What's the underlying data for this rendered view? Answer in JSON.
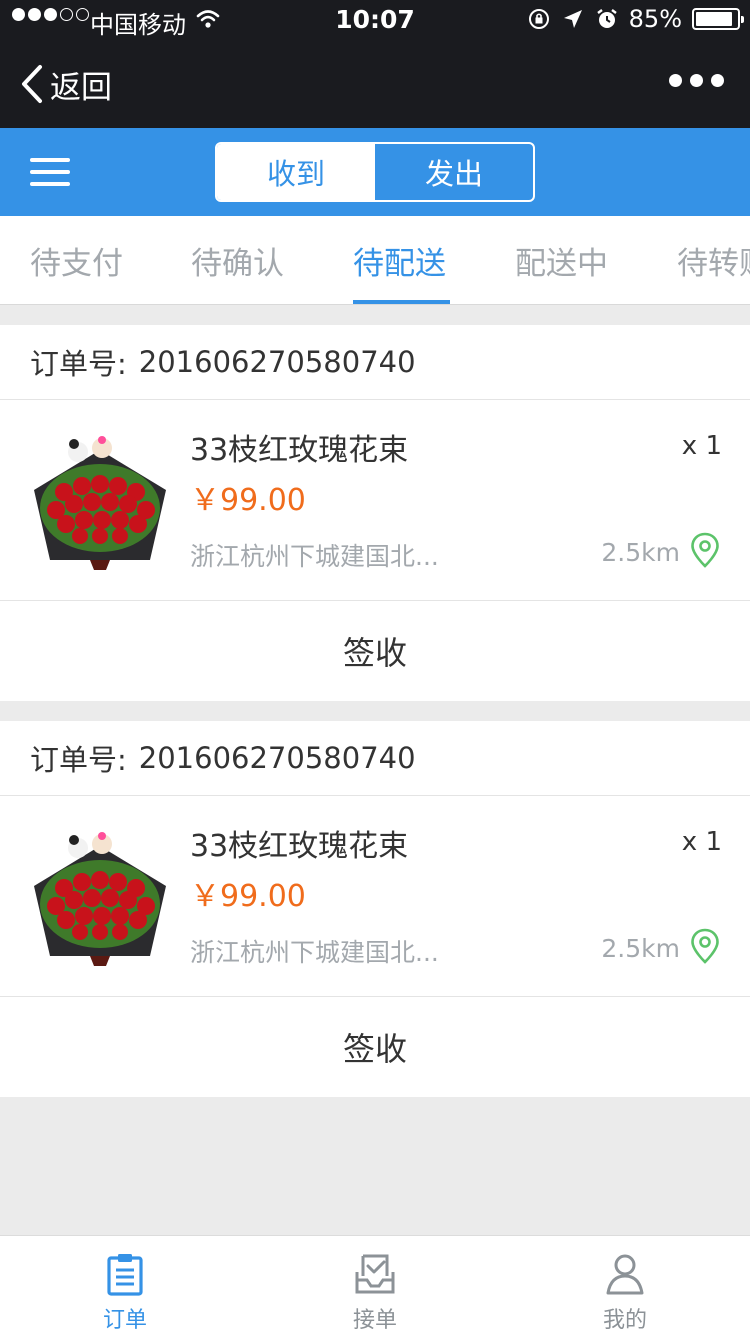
{
  "status_bar": {
    "carrier": "中国移动",
    "time": "10:07",
    "battery": "85%",
    "battery_level": 0.85
  },
  "nav": {
    "back_label": "返回"
  },
  "header": {
    "segments": [
      "收到",
      "发出"
    ],
    "active_segment": "发出"
  },
  "tabs": {
    "items": [
      "待支付",
      "待确认",
      "待配送",
      "配送中",
      "待转账"
    ],
    "active": "待配送"
  },
  "orders": [
    {
      "order_label": "订单号:",
      "order_number": "201606270580740",
      "product_name": "33枝红玫瑰花束",
      "quantity": "x 1",
      "price": "￥99.00",
      "address": "浙江杭州下城建国北...",
      "distance": "2.5km",
      "action_label": "签收"
    },
    {
      "order_label": "订单号:",
      "order_number": "201606270580740",
      "product_name": "33枝红玫瑰花束",
      "quantity": "x 1",
      "price": "￥99.00",
      "address": "浙江杭州下城建国北...",
      "distance": "2.5km",
      "action_label": "签收"
    }
  ],
  "tabbar": {
    "items": [
      {
        "label": "订单",
        "icon": "clipboard-icon",
        "active": true
      },
      {
        "label": "接单",
        "icon": "inbox-check-icon",
        "active": false
      },
      {
        "label": "我的",
        "icon": "user-icon",
        "active": false
      }
    ]
  },
  "colors": {
    "accent": "#3592e6",
    "price": "#f06c1c",
    "nav_bg": "#1a1b1f",
    "pin": "#5cc36a"
  }
}
